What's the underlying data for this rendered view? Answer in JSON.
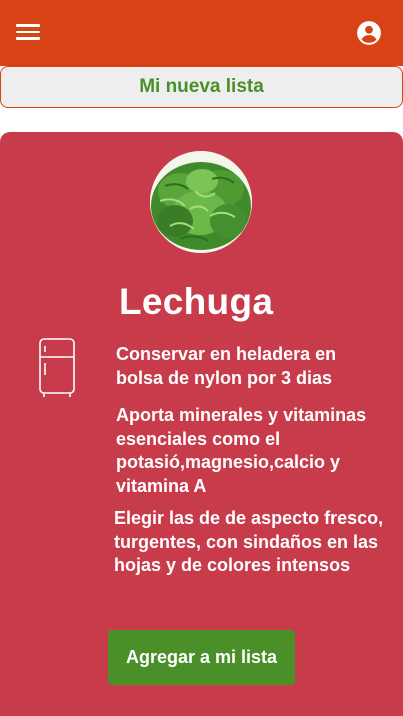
{
  "header": {
    "menu_icon": "hamburger-menu-icon",
    "account_icon": "account-circle-icon",
    "bar_color": "#d84315"
  },
  "list_button": {
    "label": "Mi nueva lista"
  },
  "product": {
    "name": "Lechuga",
    "image": "lettuce",
    "storage_icon": "refrigerator-icon",
    "storage_tip": "Conservar en heladera en bolsa de nylon por 3 dias",
    "nutrition_tip": "Aporta minerales y vitaminas esenciales como el potasió,magnesio,calcio y vitamina A",
    "selection_tip": "Elegir las de de aspecto fresco, turgentes, con sindaños en las hojas y de colores intensos",
    "card_color": "#c73b4b"
  },
  "actions": {
    "add_label": "Agregar a mi lista",
    "accent_color": "#4b8f29"
  }
}
